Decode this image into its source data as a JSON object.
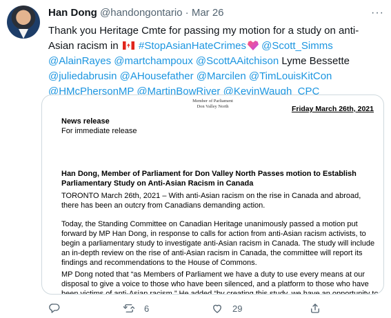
{
  "tweet": {
    "author_name": "Han Dong",
    "handle": "@handongontario",
    "separator": "·",
    "date": "Mar 26",
    "text_before": "Thank you Heritage Cmte for passing my motion for a study on anti-Asian racism in",
    "hashtag": "#StopAsianHateCrimes",
    "mention_1": "@Scott_Simms",
    "mention_2": "@AlainRayes",
    "mention_3": "@martchampoux",
    "mention_4": "@ScottAAitchison",
    "plain_name": "Lyme Bessette",
    "mention_5": "@juliedabrusin",
    "mention_6": "@AHousefather",
    "mention_7": "@Marcilen",
    "mention_8": "@TimLouisKitCon",
    "mention_9": "@HMcPhersonMP",
    "mention_10": "@MartinBowRiver",
    "mention_11": "@KevinWaugh_CPC",
    "emoji_1": "canadian-flag",
    "emoji_2": "purple-heart"
  },
  "document": {
    "letterhead_line1": "Member of Parliament",
    "letterhead_line2": "Don Valley North",
    "date_label": "Friday March 26th, 2021",
    "release_title": "News release",
    "release_sub": "For immediate release",
    "headline": "Han Dong, Member of Parliament for Don Valley North Passes motion to Establish Parliamentary Study on Anti-Asian Racism in Canada",
    "para_1": "TORONTO March 26th, 2021 – With anti-Asian racism on the rise in Canada and abroad, there has been an outcry from Canadians demanding action.",
    "para_2": "Today, the Standing Committee on Canadian Heritage unanimously passed a motion put forward by MP Han Dong, in response to calls for action from anti-Asian racism activists, to begin a parliamentary study to investigate anti-Asian racism in Canada. The study will include an in-depth review on the rise of anti-Asian racism in Canada, the committee will report its findings and recommendations to the House of Commons.",
    "para_3": "MP Dong noted that “as Members of Parliament we have a duty to use every means at our disposal to give a voice to those who have been silenced, and a platform to those who have been victims of anti-Asian racism.” He added “by creating this study, we have an opportunity to"
  },
  "actions": {
    "reply_icon": "reply-icon",
    "retweet_icon": "retweet-icon",
    "retweet_count": "6",
    "like_icon": "heart-icon",
    "like_count": "29",
    "share_icon": "share-icon"
  },
  "colors": {
    "link": "#1b95e0",
    "secondary_text": "#536471",
    "primary_text": "#0f1419",
    "border": "#cfd9de"
  }
}
